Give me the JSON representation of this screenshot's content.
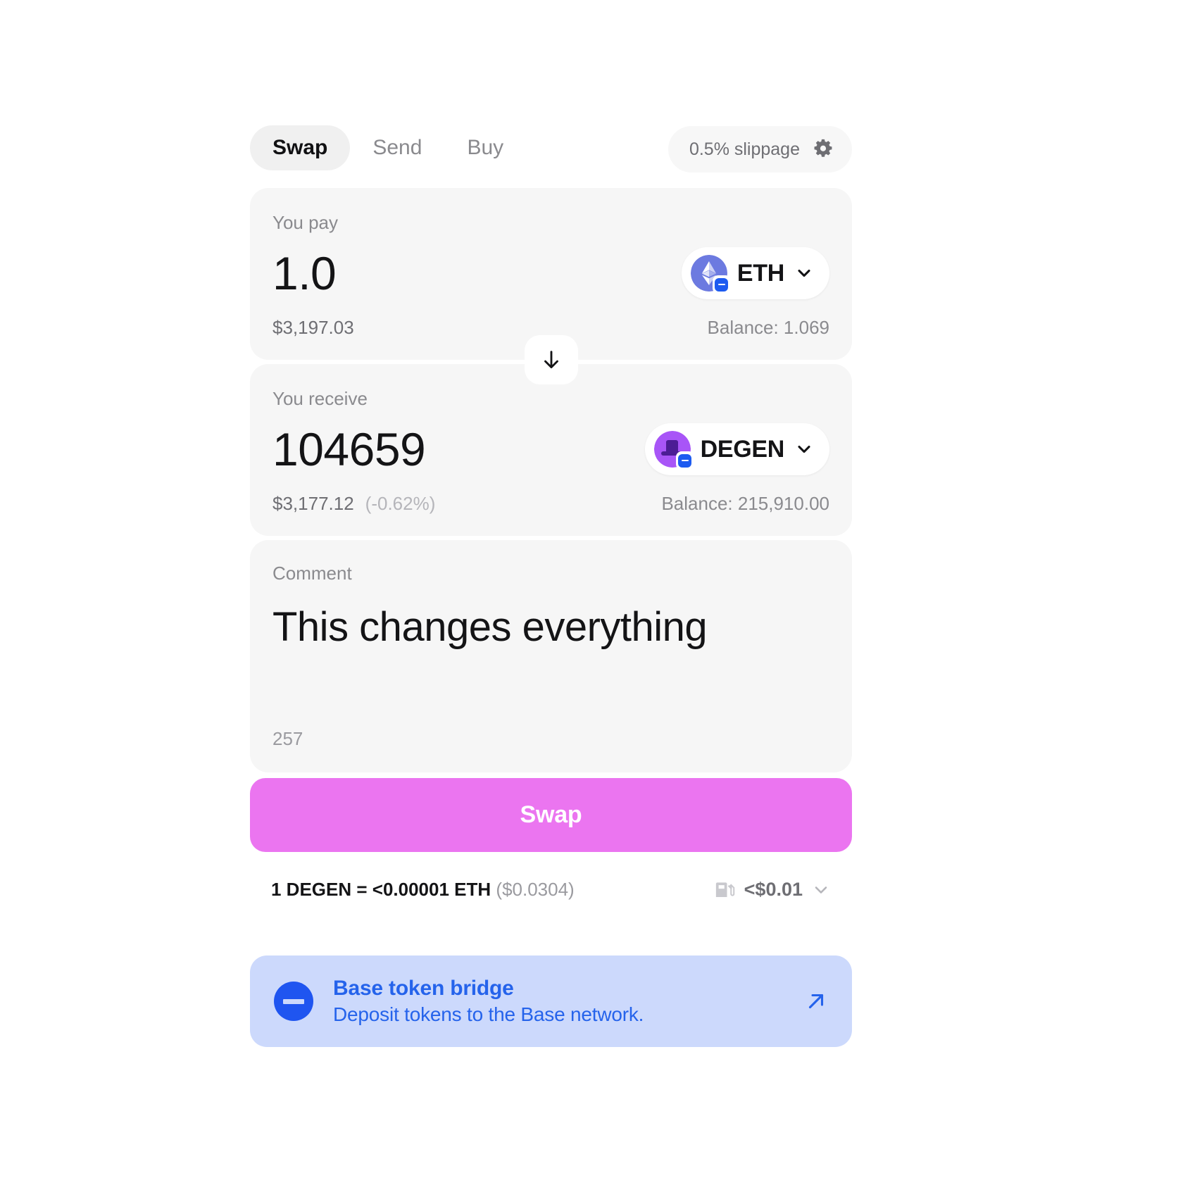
{
  "tabs": [
    {
      "label": "Swap",
      "active": true
    },
    {
      "label": "Send",
      "active": false
    },
    {
      "label": "Buy",
      "active": false
    }
  ],
  "settings": {
    "slippage_label": "0.5% slippage",
    "gear_icon": "gear-icon"
  },
  "pay": {
    "label": "You pay",
    "amount": "1.0",
    "usd_value": "$3,197.03",
    "balance": "Balance: 1.069",
    "token": {
      "symbol": "ETH",
      "logo_icon": "ethereum-icon",
      "logo_bg": "#6c7ae0",
      "network_badge": "base-network-badge"
    }
  },
  "direction_toggle": {
    "icon": "arrow-down-icon"
  },
  "receive": {
    "label": "You receive",
    "amount": "104659",
    "usd_value": "$3,177.12",
    "price_impact": "(-0.62%)",
    "balance": "Balance: 215,910.00",
    "token": {
      "symbol": "DEGEN",
      "logo_icon": "degen-hat-icon",
      "logo_bg": "#a855f7",
      "network_badge": "base-network-badge"
    }
  },
  "comment": {
    "label": "Comment",
    "value": "This changes everything",
    "placeholder": "Comment",
    "char_count": "257"
  },
  "action": {
    "swap_label": "Swap",
    "swap_color": "#eb75f0"
  },
  "rate": {
    "text": "1 DEGEN = <0.00001 ETH",
    "usd": "($0.0304)",
    "gas_icon": "gas-pump-icon",
    "gas_amount": "<$0.01",
    "expand_icon": "chevron-down-icon"
  },
  "banner": {
    "logo_icon": "base-logo-icon",
    "title": "Base token bridge",
    "subtitle": "Deposit tokens to the Base network.",
    "link_icon": "external-link-arrow-icon",
    "bg_color": "#ccd9fc",
    "text_color": "#2563eb"
  }
}
